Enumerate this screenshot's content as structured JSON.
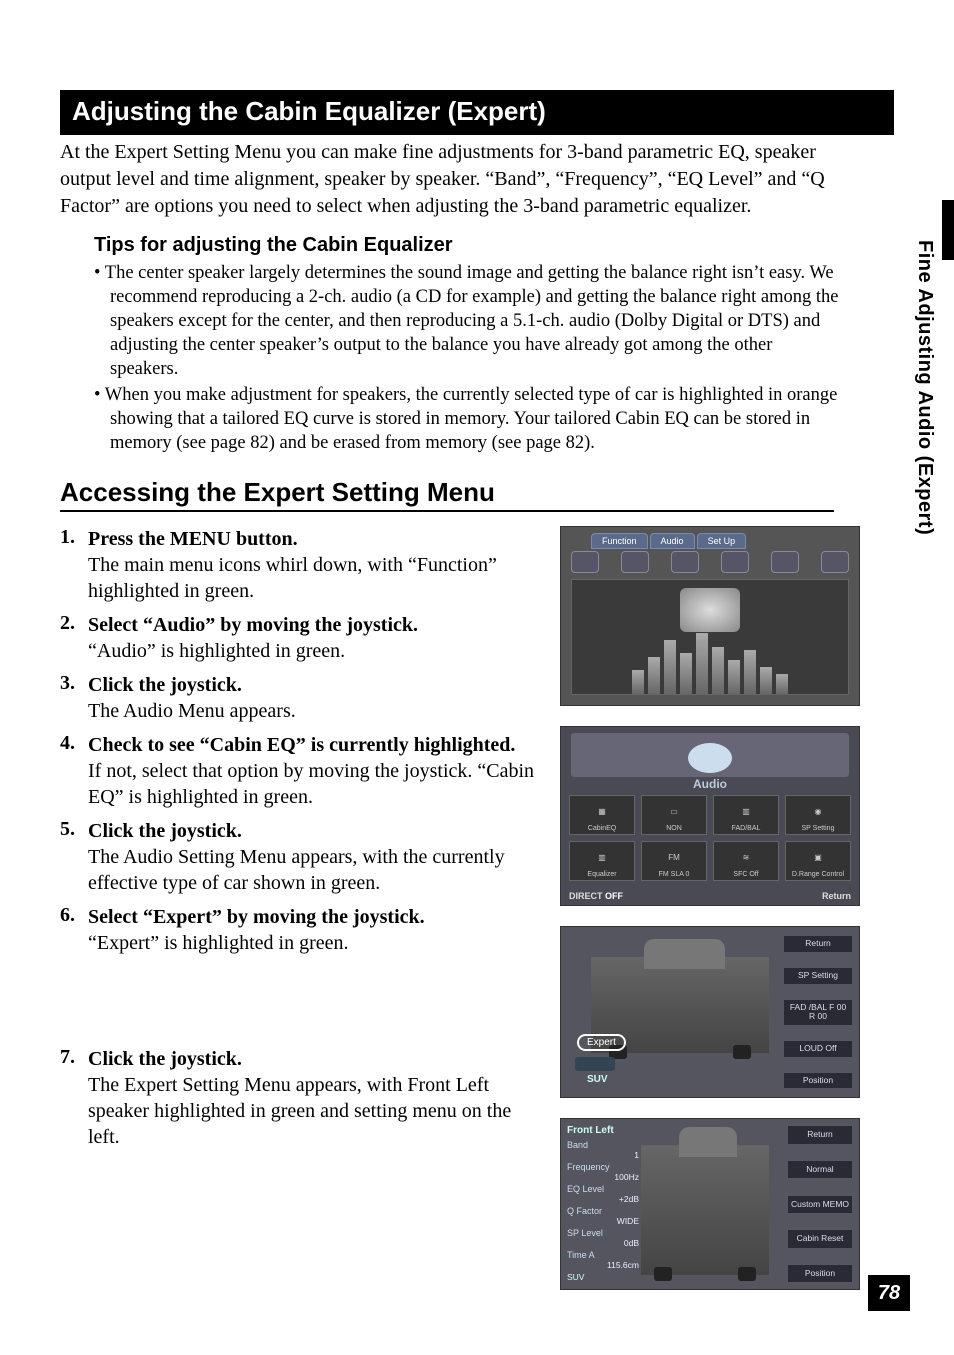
{
  "sideTab": "Fine Adjusting Audio (Expert)",
  "sectionTitle": "Adjusting the Cabin Equalizer (Expert)",
  "intro": "At the Expert Setting Menu you can make fine adjustments for 3-band parametric EQ, speaker output level and time alignment, speaker by speaker. “Band”, “Frequency”, “EQ Level” and “Q Factor” are options you need to select when adjusting the 3-band parametric equalizer.",
  "tips": {
    "heading": "Tips for adjusting the Cabin Equalizer",
    "items": [
      "The center speaker largely determines the sound image and getting the balance right isn’t easy. We recommend reproducing a 2-ch. audio (a CD for example) and getting the balance right among the speakers except for the center, and then reproducing a 5.1-ch. audio (Dolby Digital or DTS) and adjusting the center speaker’s output to the balance you have already got among the other speakers.",
      "When you make adjustment for speakers, the currently selected type of car is highlighted in orange showing that a tailored EQ curve is stored in memory. Your tailored Cabin EQ can be stored in memory (see page 82) and be erased from memory (see page 82)."
    ]
  },
  "h2": "Accessing the Expert Setting Menu",
  "steps": [
    {
      "num": "1.",
      "title": "Press the MENU button.",
      "desc": "The main menu icons whirl down, with “Function” highlighted in green."
    },
    {
      "num": "2.",
      "title": "Select “Audio” by moving the joystick.",
      "desc": "“Audio” is highlighted in green."
    },
    {
      "num": "3.",
      "title": "Click the joystick.",
      "desc": "The Audio Menu appears."
    },
    {
      "num": "4.",
      "title": "Check to see “Cabin EQ” is currently high­lighted.",
      "desc": "If not, select that option by moving the joystick. “Cabin EQ” is highlighted in green."
    },
    {
      "num": "5.",
      "title": "Click the joystick.",
      "desc": "The Audio Setting Menu appears, with the currently effective type of car shown in green."
    },
    {
      "num": "6.",
      "title": "Select “Expert” by moving the joystick.",
      "desc": "“Expert” is highlighted in green."
    },
    {
      "num": "7.",
      "title": "Click the joystick.",
      "desc": "The Expert Setting Menu appears, with Front Left speaker highlighted in green and setting menu on the left."
    }
  ],
  "shot1": {
    "tabs": [
      "Function",
      "Audio",
      "Set Up"
    ]
  },
  "shot2": {
    "title": "Audio",
    "cells": [
      "CabinEQ",
      "NON",
      "FAD/BAL",
      "SP Setting",
      "Equalizer",
      "FM SLA 0",
      "SFC Off",
      "D.Range Control"
    ],
    "bottomLeft": "DIRECT",
    "bottomLeftState": "OFF",
    "bottomRight": "Return"
  },
  "shot3": {
    "expert": "Expert",
    "suv": "SUV",
    "right": [
      "Return",
      "SP Setting",
      "FAD /BAL F 00 R 00",
      "LOUD Off",
      "Position"
    ]
  },
  "shot4": {
    "header": "Front Left",
    "left": [
      {
        "label": "Band",
        "value": "1"
      },
      {
        "label": "Frequency",
        "value": "100Hz"
      },
      {
        "label": "EQ Level",
        "value": "+2dB"
      },
      {
        "label": "Q Factor",
        "value": "WIDE"
      },
      {
        "label": "SP Level",
        "value": "0dB"
      },
      {
        "label": "Time A",
        "value": "115.6cm"
      }
    ],
    "suv": "SUV",
    "right": [
      "Return",
      "Normal",
      "Custom MEMO",
      "Cabin Reset",
      "Position"
    ]
  },
  "pageNumber": "78"
}
